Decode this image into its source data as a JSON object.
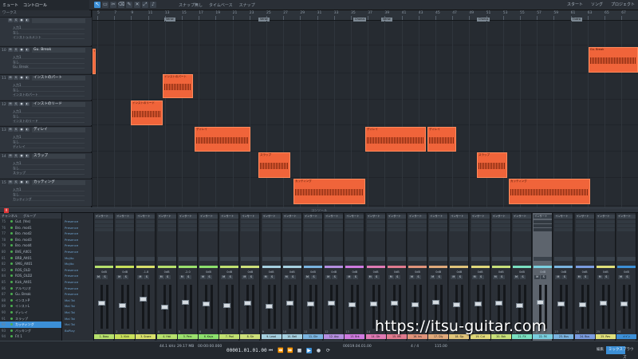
{
  "topbar": {
    "song_name": "ミュート",
    "menu_label": "コントロール",
    "menu": [
      "スナップ無し",
      "タイムベース",
      "スナップ"
    ],
    "right": [
      "スタート",
      "ソング",
      "プロジェクト"
    ]
  },
  "inspector_header": "ワークス",
  "tracks": [
    {
      "num": "",
      "name": "",
      "subs": [
        "入力1",
        "なし",
        "インストゥルメント"
      ]
    },
    {
      "num": "10",
      "name": "Gu. Break",
      "subs": [
        "入力1",
        "なし",
        "Gu. Break"
      ]
    },
    {
      "num": "11",
      "name": "インストのパート",
      "subs": [
        "入力1",
        "なし",
        "インストのパート"
      ]
    },
    {
      "num": "12",
      "name": "インストのリード",
      "subs": [
        "入力1",
        "なし",
        "インストのリード"
      ]
    },
    {
      "num": "13",
      "name": "ディレイ",
      "subs": [
        "入力1",
        "なし",
        "ディレイ"
      ]
    },
    {
      "num": "14",
      "name": "スラップ",
      "subs": [
        "入力1",
        "なし",
        "スラップ"
      ]
    },
    {
      "num": "15",
      "name": "カッティング",
      "subs": [
        "入力1",
        "なし",
        "カッティング"
      ]
    }
  ],
  "ruler": {
    "marks": [
      "5",
      "7",
      "9",
      "11",
      "13",
      "15",
      "17",
      "19",
      "21",
      "23",
      "25",
      "27",
      "29",
      "31",
      "33",
      "35",
      "37",
      "39",
      "41",
      "43",
      "45",
      "47",
      "49",
      "51",
      "53",
      "55",
      "57",
      "59",
      "61",
      "63",
      "65",
      "67"
    ],
    "flags": [
      "Verse",
      "Verse",
      "Chorus",
      "Verse",
      "Chorus",
      "Outro"
    ]
  },
  "clips": [
    {
      "title": "Gu. Break"
    },
    {
      "title": "インストのパート"
    },
    {
      "title": "インストのリード"
    },
    {
      "title": "ディレイ"
    },
    {
      "title": "ディレイ"
    },
    {
      "title": "ディレイ"
    },
    {
      "title": "スラップ"
    },
    {
      "title": "スラップ"
    },
    {
      "title": "カッティング"
    },
    {
      "title": "カッティング"
    }
  ],
  "console_strip": {
    "close": "X",
    "label": "コンソール"
  },
  "mixer_list": {
    "headers": [
      "チャンネル",
      "グループ"
    ],
    "items": [
      {
        "n": "75",
        "name": "Gut. (Yes)"
      },
      {
        "n": "76",
        "name": "Bro. mod1"
      },
      {
        "n": "77",
        "name": "Bro. mod2"
      },
      {
        "n": "78",
        "name": "Bro. mod3"
      },
      {
        "n": "79",
        "name": "Bro. mod4"
      },
      {
        "n": "80",
        "name": "BVE_Alt01"
      },
      {
        "n": "81",
        "name": "BRB_Alt01"
      },
      {
        "n": "82",
        "name": "SMG_Alt01"
      },
      {
        "n": "83",
        "name": "ROS_OLD"
      },
      {
        "n": "84",
        "name": "ROS_OLD2"
      },
      {
        "n": "85",
        "name": "Kick_Alt01"
      },
      {
        "n": "86",
        "name": "アルペジオ"
      },
      {
        "n": "87",
        "name": "Gu. Break"
      },
      {
        "n": "88",
        "name": "インストP"
      },
      {
        "n": "89",
        "name": "インストL"
      },
      {
        "n": "90",
        "name": "ディレイ"
      },
      {
        "n": "91",
        "name": "スラップ"
      },
      {
        "n": "92",
        "name": "カッティング"
      },
      {
        "n": "93",
        "name": "バッキング"
      },
      {
        "n": "94",
        "name": "FX 1"
      }
    ]
  },
  "instrument_list": [
    "Presence",
    "Presence",
    "Presence",
    "Presence",
    "Presence",
    "Presence",
    "Mojito",
    "Mojito",
    "Presence",
    "Presence",
    "Presence",
    "Presence",
    "Presence",
    "Mai Tai",
    "Mai Tai",
    "Mai Tai",
    "Mai Tai",
    "Mai Tai",
    "BoPlay"
  ],
  "channels": [
    {
      "num": "1",
      "ins": "インサート",
      "name": "1. Bass",
      "vol": "0dB",
      "fader": 0.6,
      "color": "#b6e06c"
    },
    {
      "num": "2",
      "ins": "インサート",
      "name": "2. Kick",
      "vol": "0dB",
      "fader": 0.55,
      "color": "#c8e05a"
    },
    {
      "num": "3",
      "ins": "インサート",
      "name": "3. Snare",
      "vol": "-1.8",
      "fader": 0.7,
      "color": "#d8e06a"
    },
    {
      "num": "4",
      "ins": "インサート",
      "name": "4. Hat",
      "vol": "0dB",
      "fader": 0.5,
      "color": "#b6e06c"
    },
    {
      "num": "5",
      "ins": "インサート",
      "name": "5. Perc",
      "vol": "-2.0",
      "fader": 0.62,
      "color": "#9ae06c"
    },
    {
      "num": "6",
      "ins": "インサート",
      "name": "6. Keys",
      "vol": "0dB",
      "fader": 0.58,
      "color": "#8ce06c"
    },
    {
      "num": "7",
      "ins": "インサート",
      "name": "7. Pad",
      "vol": "0dB",
      "fader": 0.55,
      "color": "#c0e070"
    },
    {
      "num": "8",
      "ins": "インサート",
      "name": "8. Str",
      "vol": "0dB",
      "fader": 0.6,
      "color": "#cde07a"
    },
    {
      "num": "9",
      "ins": "インサート",
      "name": "9. Lead",
      "vol": "0dB",
      "fader": 0.52,
      "color": "#a6d0e0"
    },
    {
      "num": "10",
      "ins": "インサート",
      "name": "10. Bell",
      "vol": "0dB",
      "fader": 0.6,
      "color": "#a6d0e0"
    },
    {
      "num": "11",
      "ins": "インサート",
      "name": "11. Gtr",
      "vol": "0dB",
      "fader": 0.58,
      "color": "#7ab4e0"
    },
    {
      "num": "12",
      "ins": "インサート",
      "name": "12. Arp",
      "vol": "0dB",
      "fader": 0.6,
      "color": "#b48ee0"
    },
    {
      "num": "13",
      "ins": "インサート",
      "name": "13. Brk",
      "vol": "0dB",
      "fader": 0.56,
      "color": "#cf7ae0"
    },
    {
      "num": "14",
      "ins": "インサート",
      "name": "14. Gtr",
      "vol": "0dB",
      "fader": 0.58,
      "color": "#e07ab4"
    },
    {
      "num": "15",
      "ins": "インサート",
      "name": "15. Ins",
      "vol": "0dB",
      "fader": 0.6,
      "color": "#e07a8e"
    },
    {
      "num": "16",
      "ins": "インサート",
      "name": "16. Ins",
      "vol": "0dB",
      "fader": 0.56,
      "color": "#e0937a"
    },
    {
      "num": "17",
      "ins": "インサート",
      "name": "17. Dly",
      "vol": "0dB",
      "fader": 0.62,
      "color": "#e0a97a"
    },
    {
      "num": "18",
      "ins": "インサート",
      "name": "18. Slp",
      "vol": "0dB",
      "fader": 0.56,
      "color": "#e0c47a"
    },
    {
      "num": "19",
      "ins": "インサート",
      "name": "19. Cut",
      "vol": "0dB",
      "fader": 0.58,
      "color": "#e0d87a"
    },
    {
      "num": "20",
      "ins": "インサート",
      "name": "20. Bck",
      "vol": "0dB",
      "fader": 0.6,
      "color": "#c8e07a"
    },
    {
      "num": "21",
      "ins": "インサート",
      "name": "21. FX",
      "vol": "0dB",
      "fader": 0.55,
      "color": "#7ae0c0"
    },
    {
      "num": "22",
      "ins": "インサート",
      "name": "22. FX",
      "vol": "0dB",
      "fader": 0.62,
      "color": "#7ad0e0"
    },
    {
      "num": "23",
      "ins": "インサート",
      "name": "23. Bus",
      "vol": "0dB",
      "fader": 0.58,
      "color": "#7ab4e0"
    },
    {
      "num": "24",
      "ins": "インサート",
      "name": "24. Bus",
      "vol": "0dB",
      "fader": 0.56,
      "color": "#7a9ce0"
    },
    {
      "num": "25",
      "ins": "インサート",
      "name": "25. Rev",
      "vol": "0dB",
      "fader": 0.6,
      "color": "#e0e07a"
    },
    {
      "num": "26",
      "ins": "インサート",
      "name": "メイン",
      "vol": "0dB",
      "fader": 0.58,
      "color": "#3c8fd6"
    }
  ],
  "transport": {
    "sample_rate": "44.1 kHz",
    "mb": "29.17 MB",
    "time": "00001.01.01.00",
    "secs": "00:00:00.000",
    "bars": "00019.04.01.00",
    "meter": "4 / 4",
    "tempo": "115.00",
    "tabs": [
      "編集",
      "ミックス",
      "ブラウズ"
    ]
  },
  "watermark": "https://itsu-guitar.com"
}
